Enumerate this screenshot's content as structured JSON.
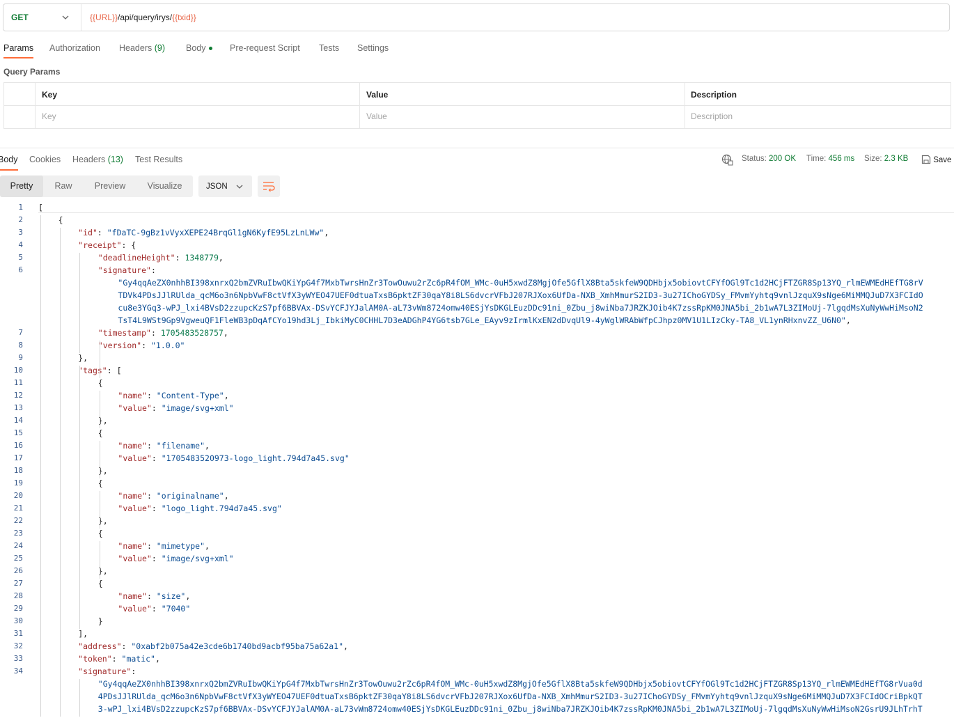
{
  "request": {
    "method": "GET",
    "url_var1": "{{URL}}",
    "url_mid": "/api/query/irys/",
    "url_var2": "{{txid}}"
  },
  "request_tabs": {
    "params": "Params",
    "authorization": "Authorization",
    "headers_label": "Headers",
    "headers_count": "(9)",
    "body": "Body",
    "prerequest": "Pre-request Script",
    "tests": "Tests",
    "settings": "Settings"
  },
  "query_params": {
    "title": "Query Params",
    "columns": [
      "Key",
      "Value",
      "Description"
    ],
    "placeholders": [
      "Key",
      "Value",
      "Description"
    ]
  },
  "response_tabs": {
    "body": "Body",
    "cookies": "Cookies",
    "headers_label": "Headers",
    "headers_count": "(13)",
    "test_results": "Test Results"
  },
  "status": {
    "status_label": "Status:",
    "status_value": "200 OK",
    "time_label": "Time:",
    "time_value": "456 ms",
    "size_label": "Size:",
    "size_value": "2.3 KB",
    "save_label": "Save"
  },
  "view": {
    "pretty": "Pretty",
    "raw": "Raw",
    "preview": "Preview",
    "visualize": "Visualize",
    "format": "JSON"
  },
  "code_lines": [
    {
      "n": "1",
      "indent": 0,
      "parts": [
        [
          "p",
          "["
        ]
      ]
    },
    {
      "n": "2",
      "indent": 1,
      "parts": [
        [
          "p",
          "{"
        ]
      ]
    },
    {
      "n": "3",
      "indent": 2,
      "parts": [
        [
          "k",
          "\"id\""
        ],
        [
          "p",
          ": "
        ],
        [
          "s",
          "\"fDaTC-9gBz1vVyxXEPE24BrqGl1gN6KyfE95LzLnLWw\""
        ],
        [
          "p",
          ","
        ]
      ]
    },
    {
      "n": "4",
      "indent": 2,
      "parts": [
        [
          "k",
          "\"receipt\""
        ],
        [
          "p",
          ": {"
        ]
      ]
    },
    {
      "n": "5",
      "indent": 3,
      "parts": [
        [
          "k",
          "\"deadlineHeight\""
        ],
        [
          "p",
          ": "
        ],
        [
          "n",
          "1348779"
        ],
        [
          "p",
          ","
        ]
      ]
    },
    {
      "n": "6",
      "indent": 3,
      "parts": [
        [
          "k",
          "\"signature\""
        ],
        [
          "p",
          ":"
        ]
      ]
    },
    {
      "n": "",
      "indent": 4,
      "parts": [
        [
          "s",
          "\"Gy4qqAeZX0nhhBI398xnrxQ2bmZVRuIbwQKiYpG4f7MxbTwrsHnZr3TowOuwu2rZc6pR4fOM_WMc-0uH5xwdZ8MgjOfe5GflX8Bta5skfeW9QDHbjx5obiovtCFYfOGl9Tc1d2HCjFTZGR8Sp13YQ_rlmEWMEdHEfTG8rV"
        ]
      ]
    },
    {
      "n": "",
      "indent": 4,
      "parts": [
        [
          "s",
          "TDVk4PDsJJlRUlda_qcM6o3n6NpbVwF8ctVfX3yWYEO47UEF0dtuaTxsB6pktZF30qaY8i8LS6dvcrVFbJ207RJXox6UfDa-NXB_XmhMmurS2ID3-3u27IChoGYDSy_FMvmYyhtq9vnlJzquX9sNge6MiMMQJuD7X3FCIdO"
        ]
      ]
    },
    {
      "n": "",
      "indent": 4,
      "parts": [
        [
          "s",
          "cu8e3YGq3-wPJ_lxi4BVsD2zzupcKzS7pf6BBVAx-DSvYCFJYJalAM0A-aL73vWm8724omw40ESjYsDKGLEuzDDc91ni_0Zbu_j8wiNba7JRZKJOib4K7zssRpKM0JNA5bi_2b1wA7L3ZIMoUj-7lgqdMsXuNyWwHiMsoN2"
        ]
      ]
    },
    {
      "n": "",
      "indent": 4,
      "parts": [
        [
          "s",
          "TsT4L9WSt9Gp9VgweuQF1FleWB3pDqAfCYo19hd3Lj_IbkiMyC0CHHL7D3eADGhP4YG6tsb7GLe_EAyv9zIrmlKxEN2dDvqUl9-4yWglWRAbWfpCJhpz0MV1U1LIzCky-TA8_VL1ynRHxnvZZ_U6N0\""
        ],
        [
          "p",
          ","
        ]
      ]
    },
    {
      "n": "7",
      "indent": 3,
      "parts": [
        [
          "k",
          "\"timestamp\""
        ],
        [
          "p",
          ": "
        ],
        [
          "n",
          "1705483528757"
        ],
        [
          "p",
          ","
        ]
      ]
    },
    {
      "n": "8",
      "indent": 3,
      "parts": [
        [
          "k",
          "\"version\""
        ],
        [
          "p",
          ": "
        ],
        [
          "s",
          "\"1.0.0\""
        ]
      ]
    },
    {
      "n": "9",
      "indent": 2,
      "parts": [
        [
          "p",
          "},"
        ]
      ]
    },
    {
      "n": "10",
      "indent": 2,
      "parts": [
        [
          "k",
          "\"tags\""
        ],
        [
          "p",
          ": ["
        ]
      ]
    },
    {
      "n": "11",
      "indent": 3,
      "parts": [
        [
          "p",
          "{"
        ]
      ]
    },
    {
      "n": "12",
      "indent": 4,
      "parts": [
        [
          "k",
          "\"name\""
        ],
        [
          "p",
          ": "
        ],
        [
          "s",
          "\"Content-Type\""
        ],
        [
          "p",
          ","
        ]
      ]
    },
    {
      "n": "13",
      "indent": 4,
      "parts": [
        [
          "k",
          "\"value\""
        ],
        [
          "p",
          ": "
        ],
        [
          "s",
          "\"image/svg+xml\""
        ]
      ]
    },
    {
      "n": "14",
      "indent": 3,
      "parts": [
        [
          "p",
          "},"
        ]
      ]
    },
    {
      "n": "15",
      "indent": 3,
      "parts": [
        [
          "p",
          "{"
        ]
      ]
    },
    {
      "n": "16",
      "indent": 4,
      "parts": [
        [
          "k",
          "\"name\""
        ],
        [
          "p",
          ": "
        ],
        [
          "s",
          "\"filename\""
        ],
        [
          "p",
          ","
        ]
      ]
    },
    {
      "n": "17",
      "indent": 4,
      "parts": [
        [
          "k",
          "\"value\""
        ],
        [
          "p",
          ": "
        ],
        [
          "s",
          "\"1705483520973-logo_light.794d7a45.svg\""
        ]
      ]
    },
    {
      "n": "18",
      "indent": 3,
      "parts": [
        [
          "p",
          "},"
        ]
      ]
    },
    {
      "n": "19",
      "indent": 3,
      "parts": [
        [
          "p",
          "{"
        ]
      ]
    },
    {
      "n": "20",
      "indent": 4,
      "parts": [
        [
          "k",
          "\"name\""
        ],
        [
          "p",
          ": "
        ],
        [
          "s",
          "\"originalname\""
        ],
        [
          "p",
          ","
        ]
      ]
    },
    {
      "n": "21",
      "indent": 4,
      "parts": [
        [
          "k",
          "\"value\""
        ],
        [
          "p",
          ": "
        ],
        [
          "s",
          "\"logo_light.794d7a45.svg\""
        ]
      ]
    },
    {
      "n": "22",
      "indent": 3,
      "parts": [
        [
          "p",
          "},"
        ]
      ]
    },
    {
      "n": "23",
      "indent": 3,
      "parts": [
        [
          "p",
          "{"
        ]
      ]
    },
    {
      "n": "24",
      "indent": 4,
      "parts": [
        [
          "k",
          "\"name\""
        ],
        [
          "p",
          ": "
        ],
        [
          "s",
          "\"mimetype\""
        ],
        [
          "p",
          ","
        ]
      ]
    },
    {
      "n": "25",
      "indent": 4,
      "parts": [
        [
          "k",
          "\"value\""
        ],
        [
          "p",
          ": "
        ],
        [
          "s",
          "\"image/svg+xml\""
        ]
      ]
    },
    {
      "n": "26",
      "indent": 3,
      "parts": [
        [
          "p",
          "},"
        ]
      ]
    },
    {
      "n": "27",
      "indent": 3,
      "parts": [
        [
          "p",
          "{"
        ]
      ]
    },
    {
      "n": "28",
      "indent": 4,
      "parts": [
        [
          "k",
          "\"name\""
        ],
        [
          "p",
          ": "
        ],
        [
          "s",
          "\"size\""
        ],
        [
          "p",
          ","
        ]
      ]
    },
    {
      "n": "29",
      "indent": 4,
      "parts": [
        [
          "k",
          "\"value\""
        ],
        [
          "p",
          ": "
        ],
        [
          "s",
          "\"7040\""
        ]
      ]
    },
    {
      "n": "30",
      "indent": 3,
      "parts": [
        [
          "p",
          "}"
        ]
      ]
    },
    {
      "n": "31",
      "indent": 2,
      "parts": [
        [
          "p",
          "],"
        ]
      ]
    },
    {
      "n": "32",
      "indent": 2,
      "parts": [
        [
          "k",
          "\"address\""
        ],
        [
          "p",
          ": "
        ],
        [
          "s",
          "\"0xabf2b075a42e3cde6b1740bd9acbf95ba75a62a1\""
        ],
        [
          "p",
          ","
        ]
      ]
    },
    {
      "n": "33",
      "indent": 2,
      "parts": [
        [
          "k",
          "\"token\""
        ],
        [
          "p",
          ": "
        ],
        [
          "s",
          "\"matic\""
        ],
        [
          "p",
          ","
        ]
      ]
    },
    {
      "n": "34",
      "indent": 2,
      "parts": [
        [
          "k",
          "\"signature\""
        ],
        [
          "p",
          ":"
        ]
      ]
    },
    {
      "n": "",
      "indent": 3,
      "parts": [
        [
          "s",
          "\"Gy4qqAeZX0nhhBI398xnrxQ2bmZVRuIbwQKiYpG4f7MxbTwrsHnZr3TowOuwu2rZc6pR4fOM_WMc-0uH5xwdZ8MgjOfe5GflX8Bta5skfeW9QDHbjx5obiovtCFYfOGl9Tc1d2HCjFTZGR8Sp13YQ_rlmEWMEdHEfTG8rVua0d"
        ]
      ]
    },
    {
      "n": "",
      "indent": 3,
      "parts": [
        [
          "s",
          "4PDsJJlRUlda_qcM6o3n6NpbVwF8ctVfX3yWYEO47UEF0dtuaTxsB6pktZF30qaY8i8LS6dvcrVFbJ207RJXox6UfDa-NXB_XmhMmurS2ID3-3u27IChoGYDSy_FMvmYyhtq9vnlJzquX9sNge6MiMMQJuD7X3FCIdOCriBpkQT"
        ]
      ]
    },
    {
      "n": "",
      "indent": 3,
      "parts": [
        [
          "s",
          "3-wPJ_lxi4BVsD2zzupcKzS7pf6BBVAx-DSvYCFJYJalAM0A-aL73vWm8724omw40ESjYsDKGLEuzDDc91ni_0Zbu_j8wiNba7JRZKJOib4K7zssRpKM0JNA5bi_2b1wA7L3ZIMoUj-7lgqdMsXuNyWwHiMsoN2GsrU9JLhTrhT"
        ]
      ]
    }
  ]
}
